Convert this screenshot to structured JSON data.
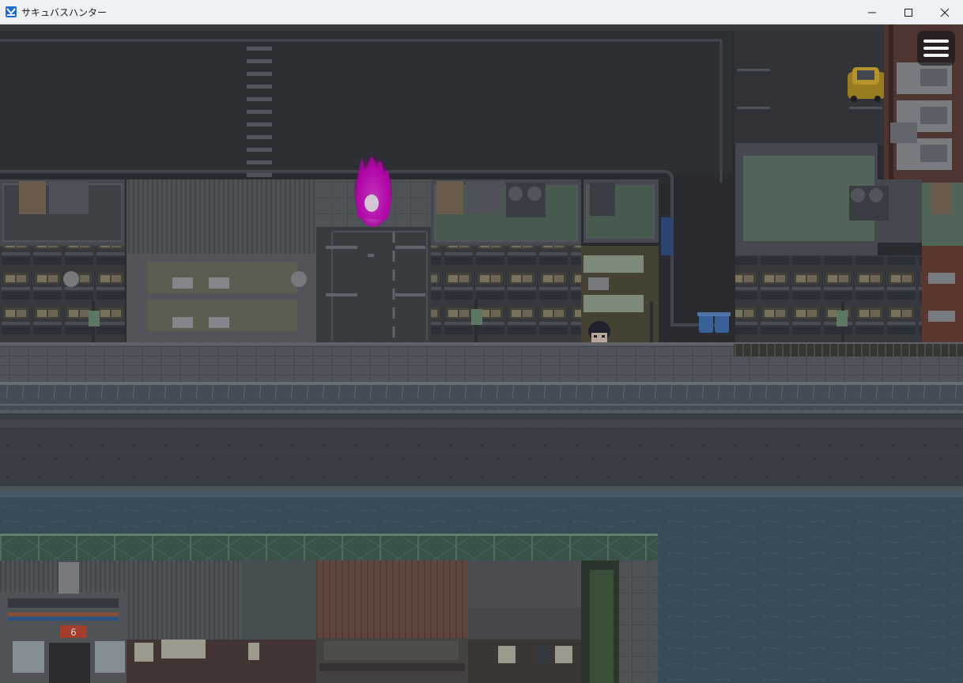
{
  "window": {
    "title": "サキュバスハンター",
    "app_icon": "game-app-icon",
    "controls": [
      "minimize-icon",
      "maximize-icon",
      "close-icon"
    ]
  },
  "game": {
    "menu_button_icon": "hamburger-menu-icon",
    "colors": {
      "overlay_tint": "#202428",
      "portal_magenta": "#d400c8",
      "car_yellow": "#e0b42a",
      "trash_can_blue": "#3f6fb0",
      "rooftop_green": "#6f8f76",
      "river": "#3d5663"
    },
    "store_sign": "6"
  }
}
